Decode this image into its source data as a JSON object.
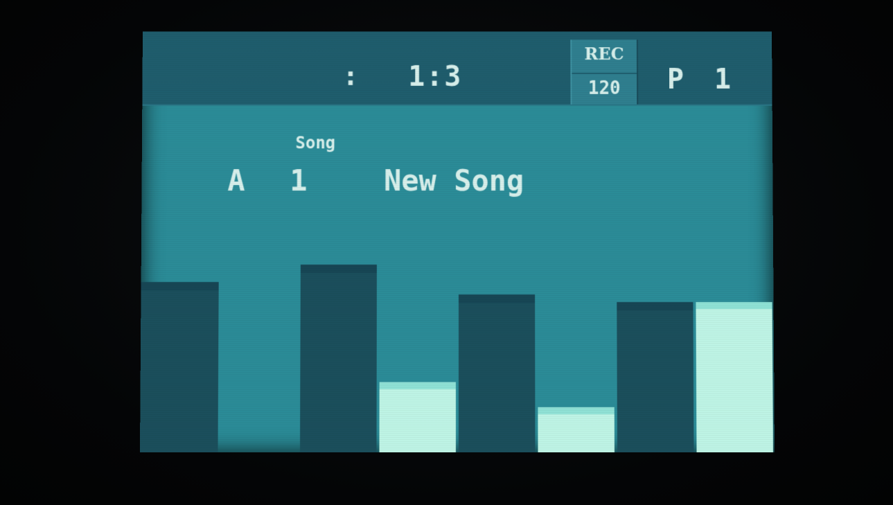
{
  "header": {
    "position_colon": ":",
    "position": "1:3",
    "rec_label": "REC",
    "tempo": "120",
    "pattern": "P 1"
  },
  "song": {
    "caption": "Song",
    "bank": "A",
    "number": "1",
    "name": "New Song"
  },
  "levels": {
    "colors": {
      "dark": "#1b4f5c",
      "light": "#bff5e6",
      "lightCap": "#8fe2d6",
      "darkCap": "#174655"
    },
    "bars": [
      {
        "style": "dark",
        "level": 0.68
      },
      {
        "style": "none",
        "level": 0
      },
      {
        "style": "dark",
        "level": 0.75
      },
      {
        "style": "light",
        "level": 0.28
      },
      {
        "style": "dark",
        "level": 0.63
      },
      {
        "style": "light",
        "level": 0.18
      },
      {
        "style": "dark",
        "level": 0.6
      },
      {
        "style": "light",
        "level": 0.6
      }
    ]
  }
}
